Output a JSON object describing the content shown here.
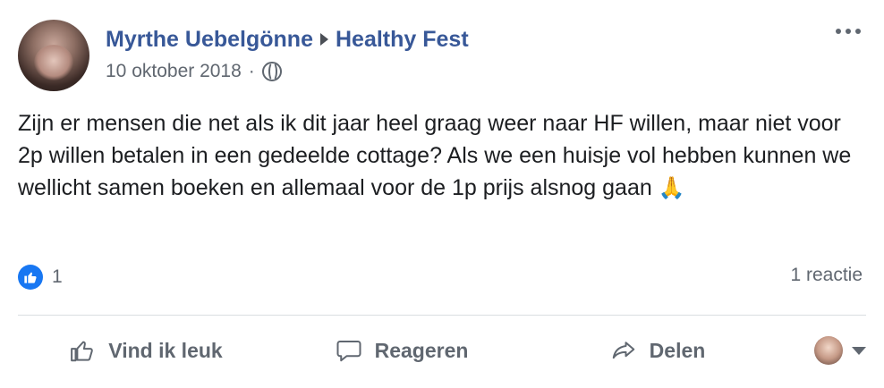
{
  "header": {
    "author": "Myrthe Uebelgönne",
    "group": "Healthy Fest",
    "date": "10 oktober 2018",
    "separator": "·"
  },
  "post": {
    "text": "Zijn er mensen die net als ik dit jaar heel graag weer naar HF willen, maar niet voor 2p willen betalen in een gedeelde cottage? Als we een huisje vol hebben kunnen we wellicht samen boeken en allemaal voor de 1p prijs alsnog gaan",
    "emoji": "🙏"
  },
  "stats": {
    "likes": "1",
    "comments": "1 reactie"
  },
  "actions": {
    "like": "Vind ik leuk",
    "comment": "Reageren",
    "share": "Delen"
  },
  "colors": {
    "link": "#385898",
    "like_badge": "#1877f2",
    "muted": "#606770"
  },
  "icons": [
    "more-options-icon",
    "globe-icon",
    "like-icon",
    "comment-icon",
    "share-icon",
    "dropdown-caret-icon"
  ]
}
